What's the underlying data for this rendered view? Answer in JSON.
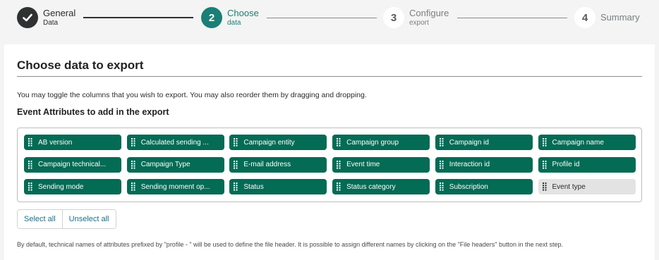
{
  "stepper": {
    "steps": [
      {
        "number": "",
        "title": "General",
        "sub": "Data",
        "state": "done",
        "icon": "check-icon"
      },
      {
        "number": "2",
        "title": "Choose",
        "sub": "data",
        "state": "active"
      },
      {
        "number": "3",
        "title": "Configure",
        "sub": "export",
        "state": "todo"
      },
      {
        "number": "4",
        "title": "Summary",
        "sub": "",
        "state": "todo"
      }
    ]
  },
  "card": {
    "title": "Choose data to export",
    "description": "You may toggle the columns that you wish to export. You may also reorder them by dragging and dropping.",
    "section_title": "Event Attributes to add in the export",
    "attributes": [
      {
        "label": "AB version",
        "selected": true
      },
      {
        "label": "Calculated sending ...",
        "selected": true
      },
      {
        "label": "Campaign entity",
        "selected": true
      },
      {
        "label": "Campaign group",
        "selected": true
      },
      {
        "label": "Campaign id",
        "selected": true
      },
      {
        "label": "Campaign name",
        "selected": true
      },
      {
        "label": "Campaign technical...",
        "selected": true
      },
      {
        "label": "Campaign Type",
        "selected": true
      },
      {
        "label": "E-mail address",
        "selected": true
      },
      {
        "label": "Event time",
        "selected": true
      },
      {
        "label": "Interaction id",
        "selected": true
      },
      {
        "label": "Profile id",
        "selected": true
      },
      {
        "label": "Sending mode",
        "selected": true
      },
      {
        "label": "Sending moment op...",
        "selected": true
      },
      {
        "label": "Status",
        "selected": true
      },
      {
        "label": "Status category",
        "selected": true
      },
      {
        "label": "Subscription",
        "selected": true
      },
      {
        "label": "Event type",
        "selected": false
      }
    ],
    "select_all_label": "Select all",
    "unselect_all_label": "Unselect all",
    "footnote": "By default, technical names of attributes prefixed by \"profile - \" will be used to define the file header. It is possible to assign different names by clicking on the \"File headers\" button in the next step."
  },
  "colors": {
    "accent": "#1a7f76",
    "chip_selected": "#046b55",
    "chip_unselected": "#e3e3e3",
    "done_step": "#2f3132"
  }
}
